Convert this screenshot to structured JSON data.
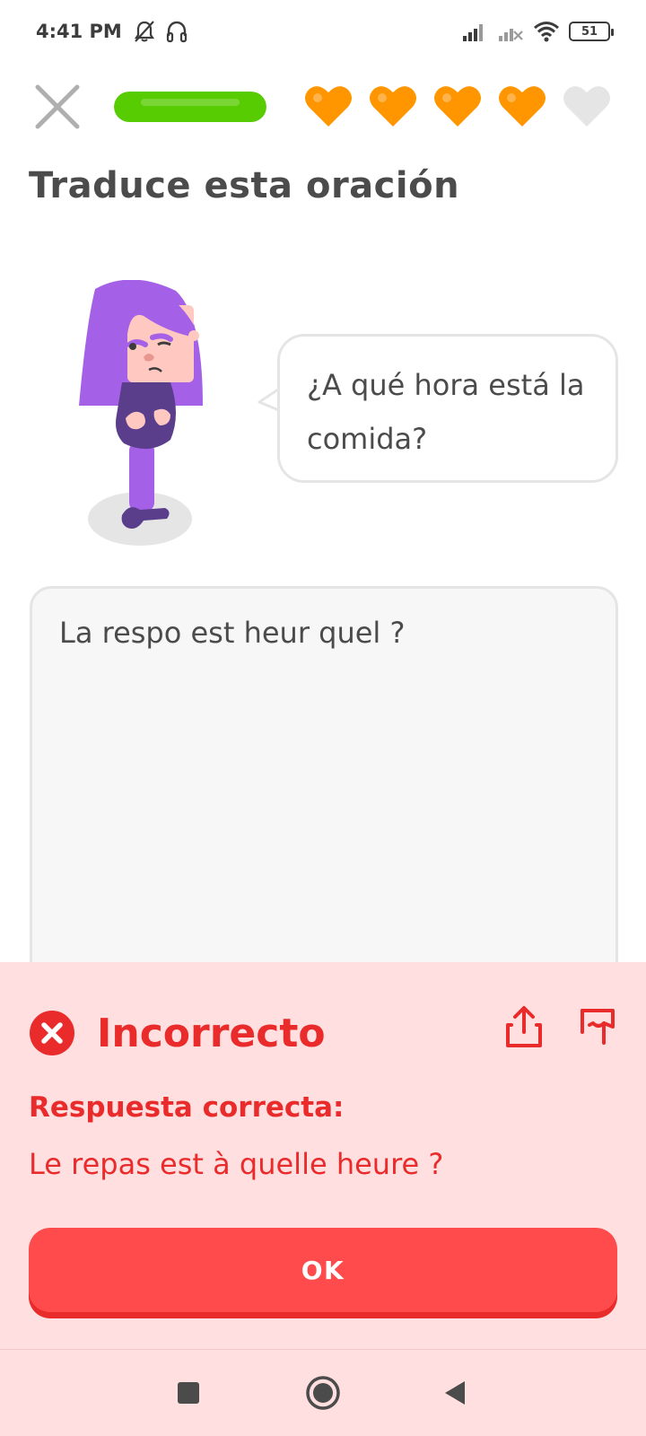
{
  "status_bar": {
    "time": "4:41 PM",
    "left_icons": [
      "notifications-muted-icon",
      "headphones-icon"
    ],
    "right_icons": [
      "signal-icon",
      "signal-no-sim-icon",
      "wifi-icon"
    ],
    "battery": "51"
  },
  "header": {
    "close_icon": "close-icon",
    "progress_fraction": 1.0,
    "hearts": [
      {
        "state": "full",
        "color": "#ff9600"
      },
      {
        "state": "full",
        "color": "#ff9600"
      },
      {
        "state": "full",
        "color": "#ff9600"
      },
      {
        "state": "full",
        "color": "#ff9600"
      },
      {
        "state": "empty",
        "color": "#e5e5e5"
      }
    ]
  },
  "exercise": {
    "instruction": "Traduce esta oración",
    "prompt_line1": "¿A qué hora está la",
    "prompt_line2": "comida?",
    "user_answer": "La respo est heur quel ?"
  },
  "feedback": {
    "status": "Incorrecto",
    "label": "Respuesta correcta:",
    "correct_answer": "Le repas est à quelle heure ?",
    "ok_label": "OK",
    "colors": {
      "panel": "#ffdfe0",
      "accent": "#ea2b2b",
      "button": "#ff4b4b"
    }
  },
  "nav_bar": {
    "buttons": [
      "recents-square-icon",
      "home-circle-icon",
      "back-triangle-icon"
    ]
  }
}
